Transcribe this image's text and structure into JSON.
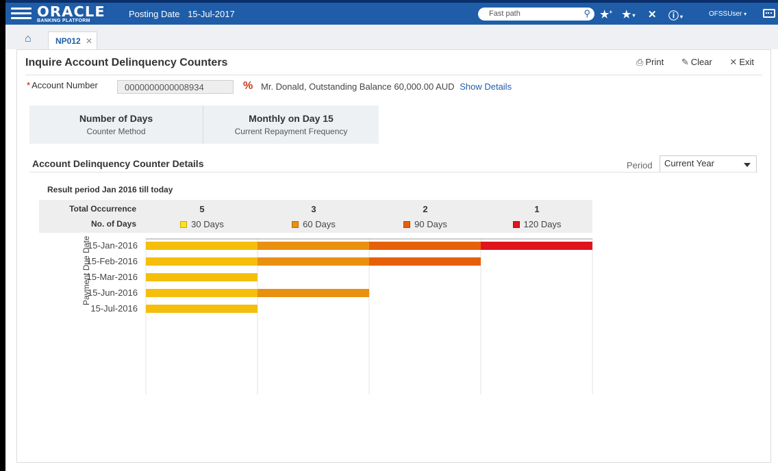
{
  "header": {
    "logo_main": "ORACLE",
    "logo_sub": "BANKING PLATFORM",
    "posting_date_label": "Posting Date",
    "posting_date_value": "15-Jul-2017",
    "fast_path_placeholder": "Fast path",
    "user": "OFSSUser",
    "icons": [
      "menu-icon",
      "search-icon",
      "favorite-add-icon",
      "favorites-icon",
      "close-all-icon",
      "info-icon",
      "window-icon"
    ]
  },
  "tabs": [
    {
      "label": "NP012",
      "closable": true
    }
  ],
  "page": {
    "title": "Inquire Account Delinquency Counters",
    "actions": [
      {
        "label": "Print",
        "icon": "print-icon"
      },
      {
        "label": "Clear",
        "icon": "eraser-icon"
      },
      {
        "label": "Exit",
        "icon": "exit-icon"
      }
    ],
    "account": {
      "label": "Account Number",
      "value": "0000000000008934",
      "description": "Mr. Donald, Outstanding Balance 60,000.00 AUD",
      "show_details": "Show Details"
    },
    "summary": [
      {
        "value": "Number of Days",
        "label": "Counter Method"
      },
      {
        "value": "Monthly on Day 15",
        "label": "Current Repayment Frequency"
      }
    ],
    "section_title": "Account Delinquency Counter Details",
    "period_label": "Period",
    "period_value": "Current Year",
    "result_period": "Result period Jan 2016 till today"
  },
  "occurrence": {
    "total_label": "Total Occurrence",
    "days_label": "No. of Days",
    "buckets": [
      {
        "total": "5",
        "label": "30 Days",
        "color": "#f5be0a"
      },
      {
        "total": "3",
        "label": "60 Days",
        "color": "#e99011"
      },
      {
        "total": "2",
        "label": "90 Days",
        "color": "#e6600c"
      },
      {
        "total": "1",
        "label": "120 Days",
        "color": "#e0141d"
      }
    ]
  },
  "chart_data": {
    "type": "bar",
    "orientation": "horizontal",
    "stacked": true,
    "ylabel": "Payment Due Date",
    "categories": [
      "15-Jan-2016",
      "15-Feb-2016",
      "15-Mar-2016",
      "15-Jun-2016",
      "15-Jul-2016"
    ],
    "series": [
      {
        "name": "30 Days",
        "color": "#f5be0a",
        "values": [
          1,
          1,
          1,
          1,
          1
        ]
      },
      {
        "name": "60 Days",
        "color": "#e99011",
        "values": [
          1,
          1,
          0,
          1,
          0
        ]
      },
      {
        "name": "90 Days",
        "color": "#e6600c",
        "values": [
          1,
          1,
          0,
          0,
          0
        ]
      },
      {
        "name": "120 Days",
        "color": "#e0141d",
        "values": [
          1,
          0,
          0,
          0,
          0
        ]
      }
    ],
    "xlim": [
      0,
      4
    ],
    "grid": true
  }
}
